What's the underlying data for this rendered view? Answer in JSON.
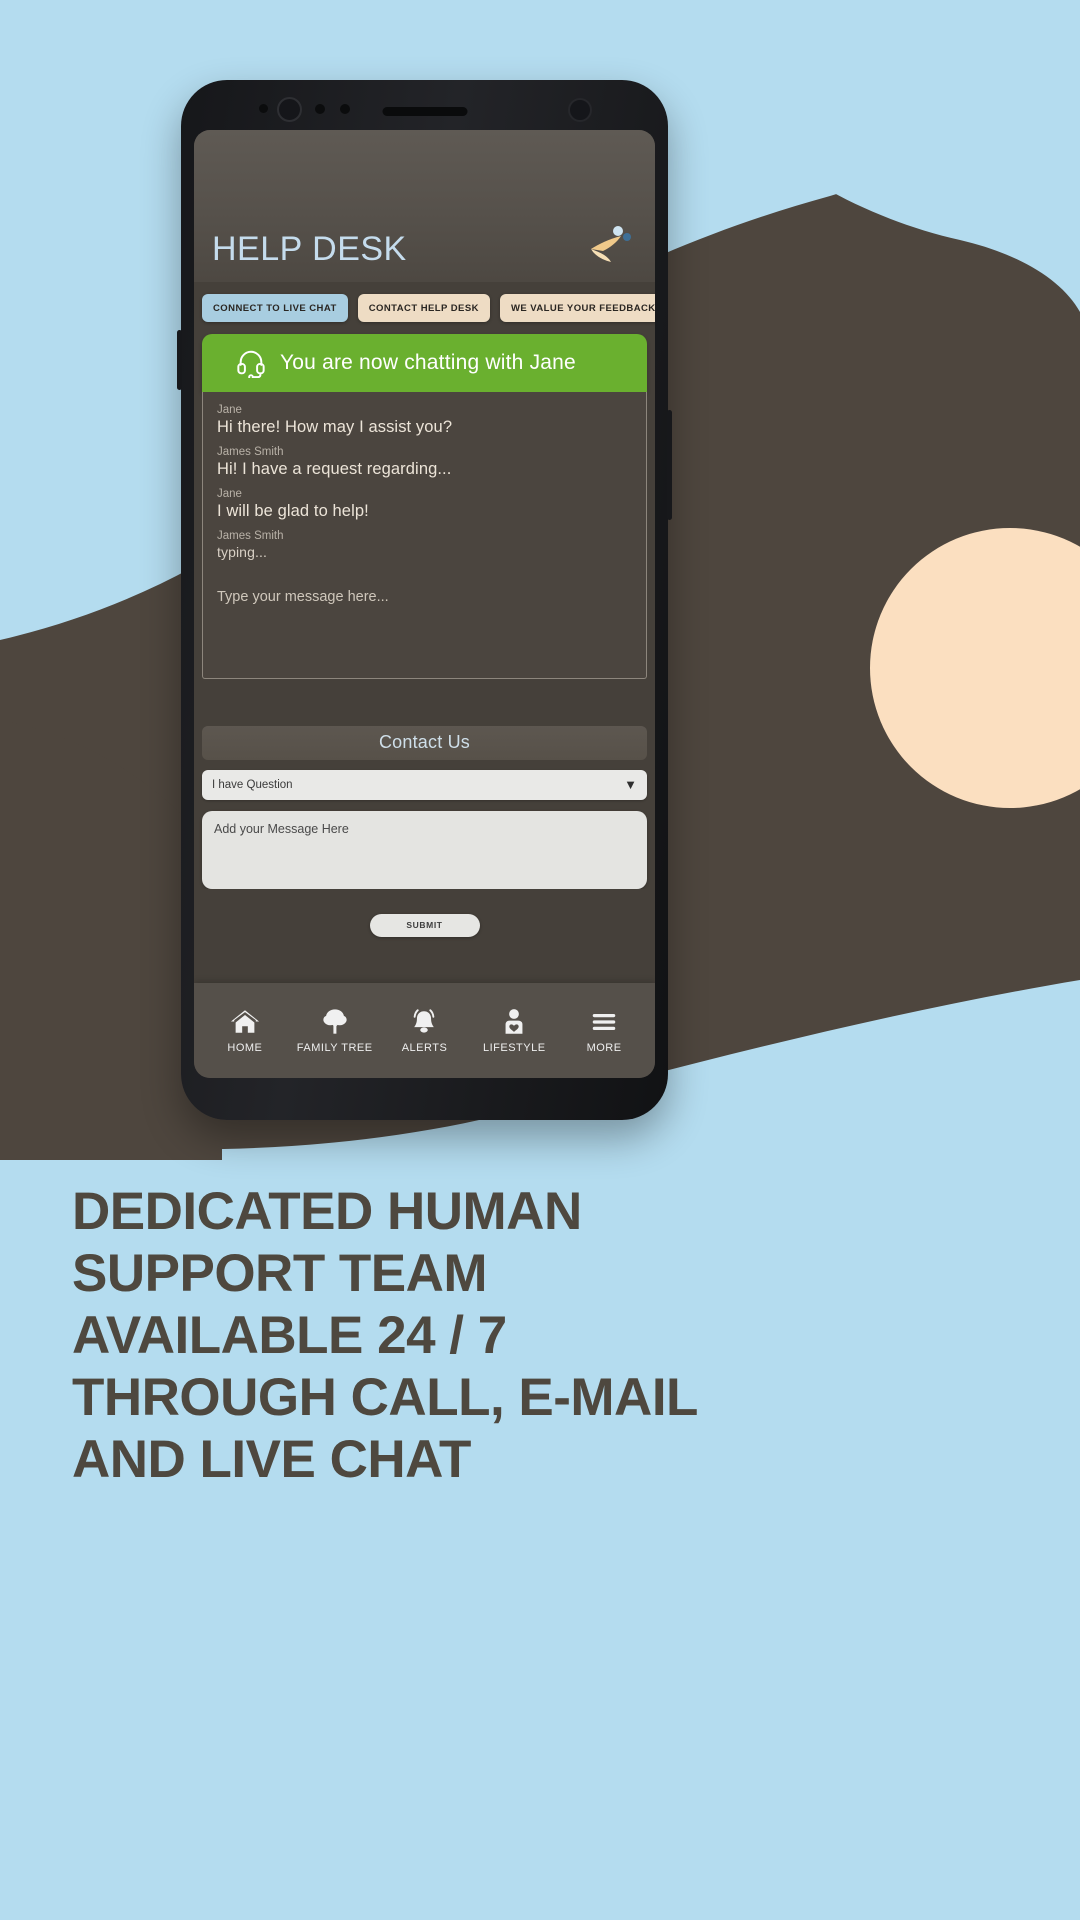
{
  "colors": {
    "page_bg": "#b4dcef",
    "blob_dark": "#4e463e",
    "blob_peach": "#fbdfc0",
    "accent_green": "#6ab02f",
    "tab_blue": "#a8cde0",
    "tab_tan": "#eedcc4",
    "title_blue": "#c5dced"
  },
  "app": {
    "title": "HELP DESK",
    "logo_icon": "bird-logo-icon"
  },
  "tabs": [
    {
      "label": "CONNECT TO LIVE CHAT",
      "style": "blue"
    },
    {
      "label": "CONTACT HELP DESK",
      "style": "tan"
    },
    {
      "label": "WE VALUE YOUR FEEDBACK",
      "style": "tan"
    }
  ],
  "chat": {
    "banner_icon": "headset-icon",
    "banner_text": "You are now chatting with Jane",
    "messages": [
      {
        "who": "Jane",
        "text": "Hi there! How may I assist you?",
        "typing": false
      },
      {
        "who": "James Smith",
        "text": "Hi! I have a request regarding...",
        "typing": false
      },
      {
        "who": "Jane",
        "text": "I will be glad to help!",
        "typing": false
      },
      {
        "who": "James Smith",
        "text": "typing...",
        "typing": true
      }
    ],
    "composer_placeholder": "Type your message here..."
  },
  "contact": {
    "heading": "Contact Us",
    "select_value": "I have Question",
    "select_caret": "▼",
    "message_placeholder": "Add your Message Here",
    "submit_label": "SUBMIT"
  },
  "bottom_nav": [
    {
      "label": "HOME",
      "icon": "home-icon"
    },
    {
      "label": "FAMILY TREE",
      "icon": "tree-icon"
    },
    {
      "label": "ALERTS",
      "icon": "bell-icon"
    },
    {
      "label": "LIFESTYLE",
      "icon": "person-heart-icon"
    },
    {
      "label": "MORE",
      "icon": "hamburger-menu-icon"
    }
  ],
  "headline": {
    "line1": "DEDICATED HUMAN",
    "line2": "SUPPORT TEAM",
    "line3": "AVAILABLE 24 / 7",
    "line4": "THROUGH CALL, E-MAIL",
    "line5": "AND LIVE CHAT"
  }
}
